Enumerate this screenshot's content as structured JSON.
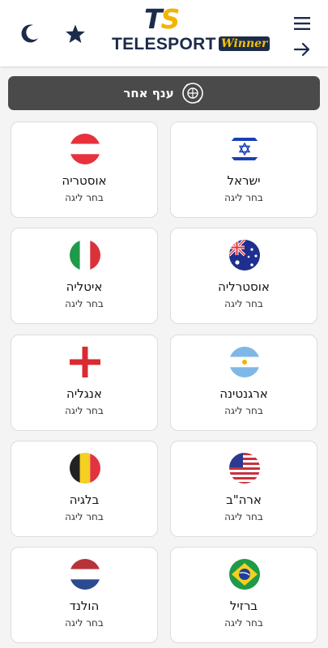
{
  "header": {
    "logo_ts_t": "T",
    "logo_ts_s": "S",
    "logo_brand": "TELESPORT",
    "logo_winner": "Winner",
    "icons": [
      "moon-icon",
      "star-icon",
      "hamburger-menu-icon",
      "arrow-right-icon"
    ],
    "icon_color": "#1c2b4a"
  },
  "other_sport": {
    "label": "ענף אחר"
  },
  "countries": [
    {
      "name": "ישראל",
      "sub": "בחר ליגה",
      "flag": "israel"
    },
    {
      "name": "אוסטריה",
      "sub": "בחר ליגה",
      "flag": "austria"
    },
    {
      "name": "אוסטרליה",
      "sub": "בחר ליגה",
      "flag": "australia"
    },
    {
      "name": "איטליה",
      "sub": "בחר ליגה",
      "flag": "italy"
    },
    {
      "name": "ארגנטינה",
      "sub": "בחר ליגה",
      "flag": "argentina"
    },
    {
      "name": "אנגליה",
      "sub": "בחר ליגה",
      "flag": "england"
    },
    {
      "name": "ארה\"ב",
      "sub": "בחר ליגה",
      "flag": "usa"
    },
    {
      "name": "בלגיה",
      "sub": "בחר ליגה",
      "flag": "belgium"
    },
    {
      "name": "ברזיל",
      "sub": "בחר ליגה",
      "flag": "brazil"
    },
    {
      "name": "הולנד",
      "sub": "בחר ליגה",
      "flag": "netherlands"
    }
  ],
  "colors": {
    "brand_navy": "#1c2b4a",
    "brand_yellow": "#f2b400",
    "other_sport_bg": "#4a4a4a",
    "card_bg": "#ffffff",
    "page_bg": "#f4f4f4"
  }
}
